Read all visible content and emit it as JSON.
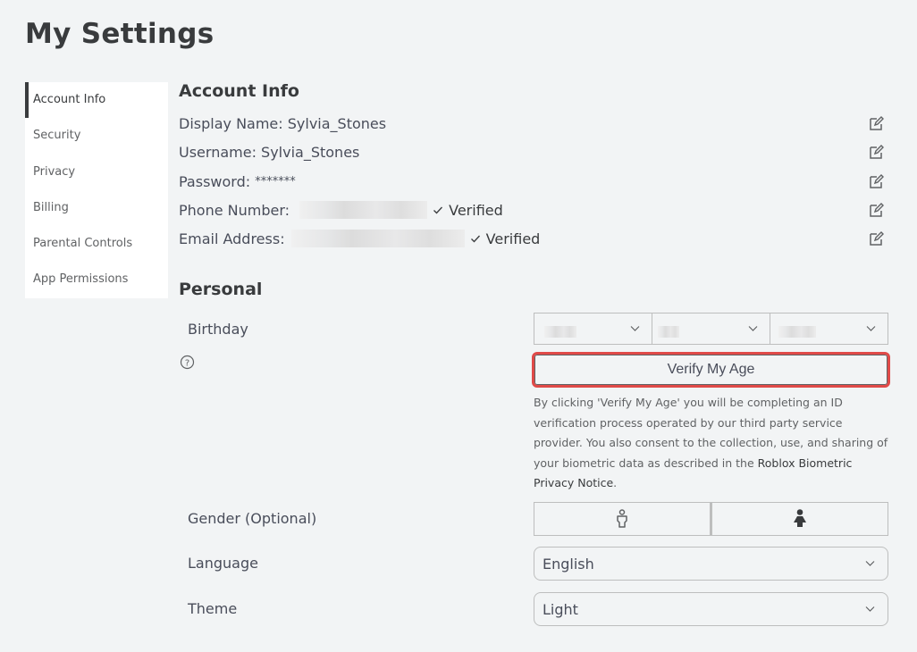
{
  "page": {
    "title": "My Settings"
  },
  "sidebar": {
    "items": [
      {
        "label": "Account Info",
        "active": true
      },
      {
        "label": "Security",
        "active": false
      },
      {
        "label": "Privacy",
        "active": false
      },
      {
        "label": "Billing",
        "active": false
      },
      {
        "label": "Parental Controls",
        "active": false
      },
      {
        "label": "App Permissions",
        "active": false
      }
    ]
  },
  "account_info": {
    "title": "Account Info",
    "display_name": {
      "label": "Display Name: ",
      "value": "Sylvia_Stones"
    },
    "username": {
      "label": "Username: ",
      "value": "Sylvia_Stones"
    },
    "password": {
      "label": "Password: ",
      "value": "*******"
    },
    "phone": {
      "label": "Phone Number: ",
      "status": "Verified",
      "redacted": true
    },
    "email": {
      "label": "Email Address: ",
      "status": "Verified",
      "redacted": true
    },
    "edit_icon": "edit-pencil-square-icon"
  },
  "personal": {
    "title": "Personal",
    "birthday": {
      "label": "Birthday",
      "month": "",
      "day": "",
      "year": "",
      "redacted": true
    },
    "help_icon": "question-circle-icon",
    "verify_button": "Verify My Age",
    "verify_highlight_color": "#e04a48",
    "disclaimer": {
      "text": "By clicking 'Verify My Age' you will be completing an ID verification process operated by our third party service provider. You also consent to the collection, use, and sharing of your biometric data as described in the ",
      "link": "Roblox Biometric Privacy Notice",
      "end": "."
    },
    "gender": {
      "label": "Gender (Optional)",
      "options": [
        {
          "name": "male",
          "icon": "male-outline-icon",
          "selected": false
        },
        {
          "name": "female",
          "icon": "female-filled-icon",
          "selected": true
        }
      ]
    },
    "language": {
      "label": "Language",
      "value": "English"
    },
    "theme": {
      "label": "Theme",
      "value": "Light"
    }
  }
}
